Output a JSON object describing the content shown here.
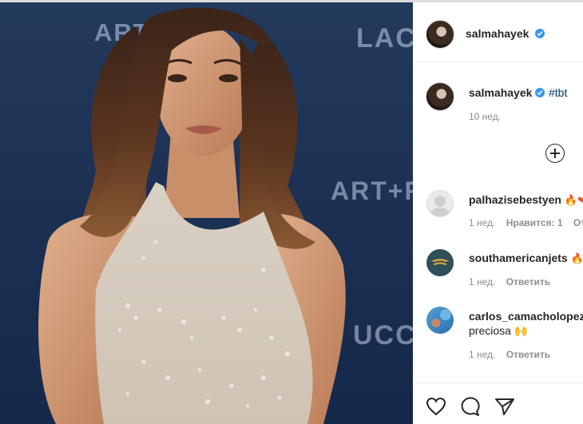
{
  "photo": {
    "backdrop_texts": [
      "ART+",
      "LACM",
      "ART+FI",
      "UCC"
    ]
  },
  "post": {
    "author": "salmahayek",
    "verified": true,
    "caption_hashtag": "#tbt",
    "time_ago": "10 нед."
  },
  "comments": [
    {
      "username": "palhazisebestyen",
      "text": "🔥❤",
      "time": "1 нед.",
      "likes": "Нравится: 1",
      "reply": "От",
      "avatar": "default-avatar"
    },
    {
      "username": "southamericanjets",
      "text": "🔥",
      "time": "1 нед.",
      "reply": "Ответить",
      "avatar": "jets-logo"
    },
    {
      "username": "carlos_camacholopez",
      "text": "preciosa 🙌",
      "time": "1 нед.",
      "reply": "Ответить",
      "avatar": "photo-avatar"
    }
  ],
  "icons": {
    "add": "plus-circle-icon",
    "like": "heart-icon",
    "comment": "comment-icon",
    "share": "paper-plane-icon"
  },
  "colors": {
    "link": "#00376b",
    "muted": "#8e8e8e",
    "verified": "#3897f0"
  }
}
